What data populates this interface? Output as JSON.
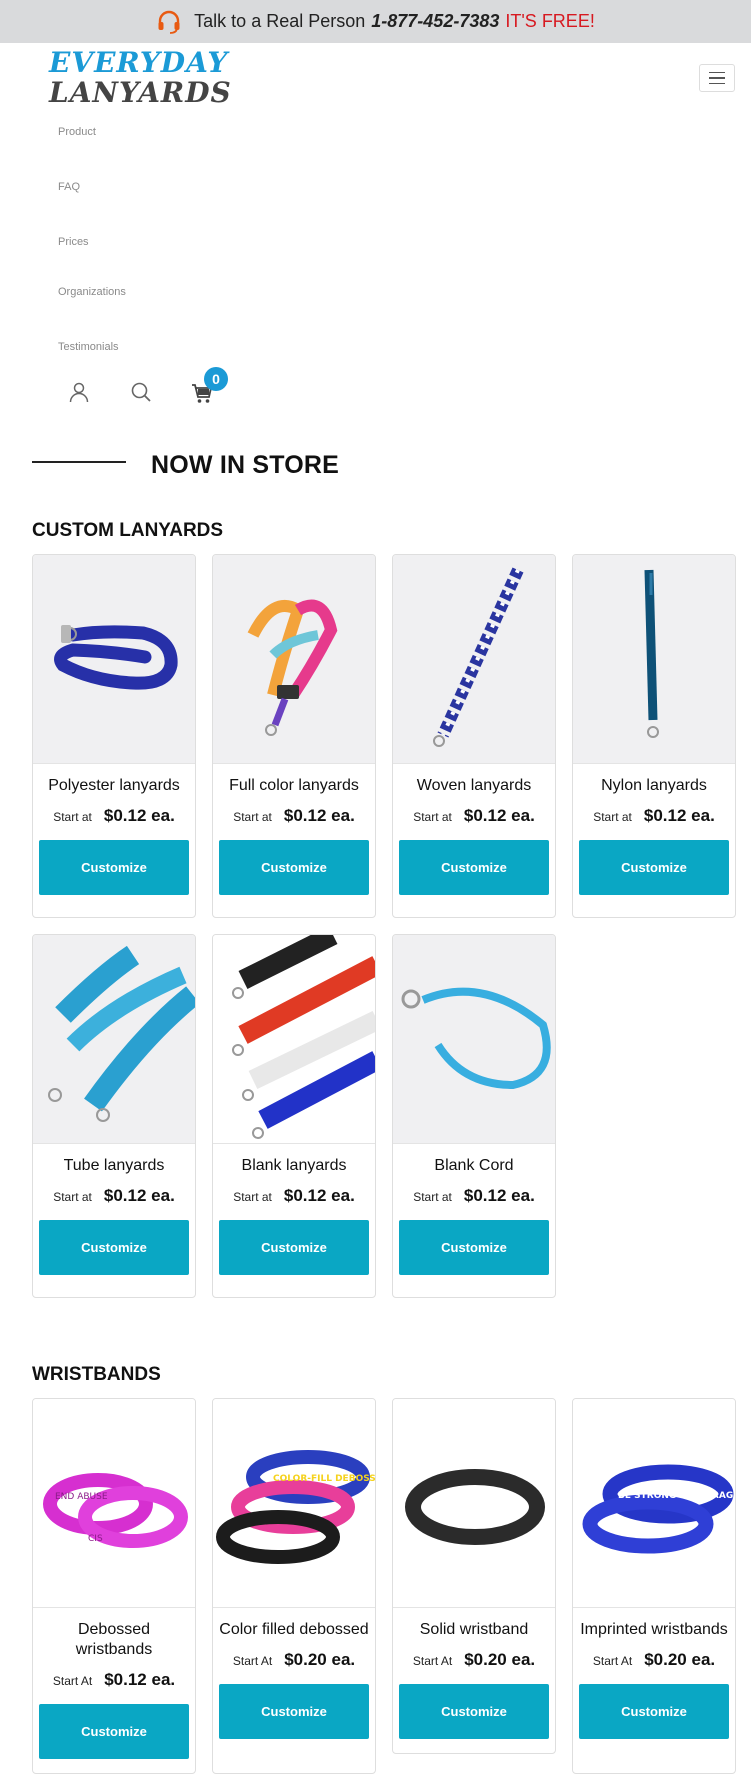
{
  "topbar": {
    "label": "Talk to a Real Person",
    "phone": "1-877-452-7383",
    "free": "IT'S FREE!"
  },
  "logo": {
    "line1": "EVERYDAY",
    "line2": "LANYARDS"
  },
  "nav": [
    "Product",
    "FAQ",
    "Prices",
    "Organizations",
    "Testimonials"
  ],
  "cart": {
    "count": "0"
  },
  "store_title": "NOW IN STORE",
  "lanyards": {
    "heading": "CUSTOM LANYARDS",
    "items": [
      {
        "name": "Polyester lanyards",
        "start": "Start at",
        "price": "$0.12 ea.",
        "button": "Customize"
      },
      {
        "name": "Full color lanyards",
        "start": "Start at",
        "price": "$0.12 ea.",
        "button": "Customize"
      },
      {
        "name": "Woven lanyards",
        "start": "Start at",
        "price": "$0.12 ea.",
        "button": "Customize"
      },
      {
        "name": "Nylon lanyards",
        "start": "Start at",
        "price": "$0.12 ea.",
        "button": "Customize"
      },
      {
        "name": "Tube lanyards",
        "start": "Start at",
        "price": "$0.12 ea.",
        "button": "Customize"
      },
      {
        "name": "Blank lanyards",
        "start": "Start at",
        "price": "$0.12 ea.",
        "button": "Customize"
      },
      {
        "name": "Blank Cord",
        "start": "Start at",
        "price": "$0.12 ea.",
        "button": "Customize"
      }
    ]
  },
  "wristbands": {
    "heading": "WRISTBANDS",
    "items": [
      {
        "name": "Debossed wristbands",
        "start": "Start At",
        "price": "$0.12 ea.",
        "button": "Customize"
      },
      {
        "name": "Color filled debossed",
        "start": "Start At",
        "price": "$0.20 ea.",
        "button": "Customize"
      },
      {
        "name": "Solid wristband",
        "start": "Start At",
        "price": "$0.20 ea.",
        "button": "Customize"
      },
      {
        "name": "Imprinted wristbands",
        "start": "Start At",
        "price": "$0.20 ea.",
        "button": "Customize"
      }
    ],
    "print_text": {
      "debossed_a": "END ABUSE",
      "debossed_b": "CIS",
      "color_filled": "COLOR-FILL DEBOSSED",
      "imprinted": "BE STRONG & COURAGE"
    }
  },
  "colors": {
    "accent": "#0aa7c4",
    "brand_blue": "#1b9ad6",
    "free_red": "#d71920",
    "topbar_bg": "#d9dadc"
  },
  "icons": [
    "headset-icon",
    "user-icon",
    "search-icon",
    "cart-icon",
    "menu-icon"
  ]
}
